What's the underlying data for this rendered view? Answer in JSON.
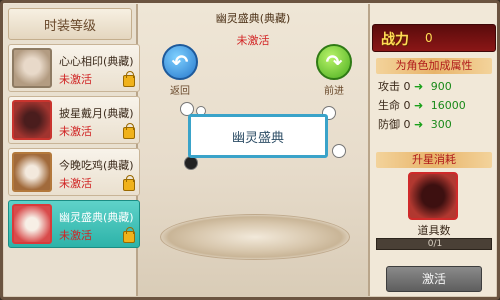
{
  "left": {
    "header": "时装等级",
    "items": [
      {
        "name": "心心相印(典藏)",
        "status": "未激活"
      },
      {
        "name": "披星戴月(典藏)",
        "status": "未激活"
      },
      {
        "name": "今晚吃鸡(典藏)",
        "status": "未激活"
      },
      {
        "name": "幽灵盛典(典藏)",
        "status": "未激活"
      }
    ]
  },
  "center": {
    "title": "幽灵盛典(典藏)",
    "status": "未激活",
    "card_label": "幽灵盛典",
    "back_label": "返回",
    "fwd_label": "前进"
  },
  "right": {
    "power_label": "战力",
    "power_value": "0",
    "attr_title": "为角色加成属性",
    "stats": [
      {
        "name": "攻击",
        "value": "900"
      },
      {
        "name": "生命",
        "value": "16000"
      },
      {
        "name": "防御",
        "value": "300"
      }
    ],
    "upgrade_title": "升星消耗",
    "item_label": "道具数",
    "progress_text": "0/1",
    "progress_fraction": 0,
    "activate_label": "激活"
  }
}
